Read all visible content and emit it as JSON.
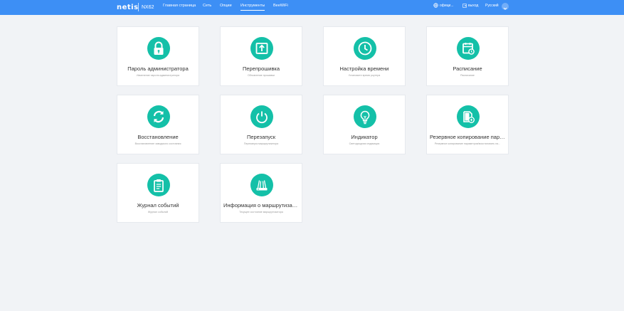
{
  "header": {
    "logo": "netis",
    "model": "NX62",
    "nav": [
      "Главная страница",
      "Сеть",
      "Опции",
      "Инструменты",
      "BeeWiFi"
    ],
    "active_nav": "Инструменты",
    "official": "офици...",
    "logout": "выход",
    "language": "Русский"
  },
  "cards": [
    {
      "title": "Пароль администратора",
      "desc": "Изменение пароля администратора",
      "icon": "lock-icon"
    },
    {
      "title": "Перепрошивка",
      "desc": "Обновление прошивки",
      "icon": "upload-icon"
    },
    {
      "title": "Настройка времени",
      "desc": "Установите время роутера",
      "icon": "clock-icon"
    },
    {
      "title": "Расписание",
      "desc": "Расписание",
      "icon": "schedule-icon"
    },
    {
      "title": "Восстановление",
      "desc": "Восстановление заводского состояния",
      "icon": "restore-icon"
    },
    {
      "title": "Перезапуск",
      "desc": "Перезапуск маршрутизатора",
      "icon": "power-icon"
    },
    {
      "title": "Индикатор",
      "desc": "Светодиодная индикация",
      "icon": "bulb-icon"
    },
    {
      "title": "Резервное копирование пара...",
      "desc": "Резервное копирование параметров/восстановить па...",
      "icon": "backup-icon"
    },
    {
      "title": "Журнал событий",
      "desc": "Журнал событий",
      "icon": "log-icon"
    },
    {
      "title": "Информация о маршрутизато...",
      "desc": "Текущее состояние маршрутизатора",
      "icon": "router-icon"
    }
  ],
  "colors": {
    "header": "#3d8ff5",
    "accent": "#14c0a8",
    "background": "#f1f3f6"
  }
}
